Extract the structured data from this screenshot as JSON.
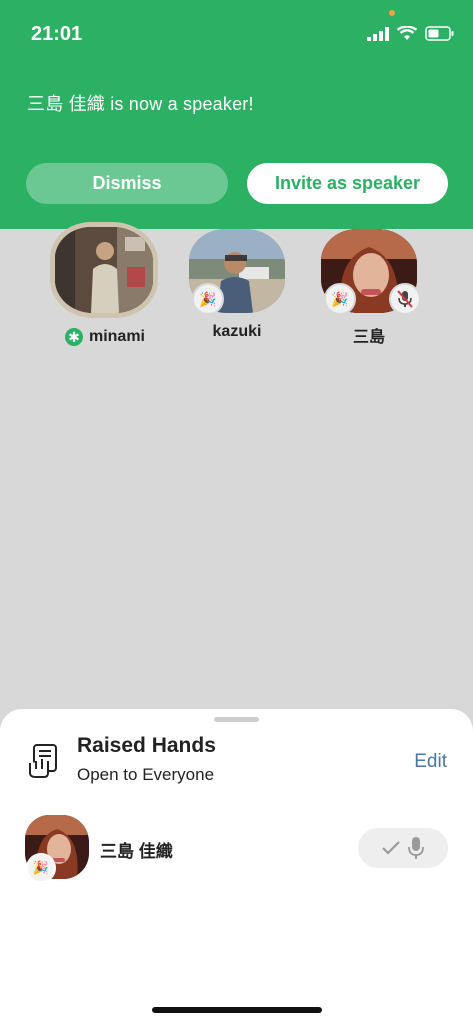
{
  "status": {
    "time": "21:01"
  },
  "banner": {
    "message": "三島 佳織 is now a speaker!",
    "dismiss_label": "Dismiss",
    "invite_label": "Invite as speaker"
  },
  "speakers": [
    {
      "name": "minami",
      "moderator_icon": "moderator-badge-icon"
    },
    {
      "name": "kazuki",
      "badge_icon": "party-popper-icon"
    },
    {
      "name": "三島",
      "badge_icon": "party-popper-icon",
      "status_icon": "mic-muted-icon"
    }
  ],
  "raised_hands": {
    "title": "Raised Hands",
    "subtitle": "Open to Everyone",
    "edit_label": "Edit",
    "items": [
      {
        "name": "三島 佳織",
        "badge_icon": "party-popper-icon",
        "action_icons": [
          "check-icon",
          "microphone-icon"
        ]
      }
    ]
  },
  "colors": {
    "brand": "#2bb064",
    "link": "#4a76a8",
    "background": "#d8d8d8"
  }
}
